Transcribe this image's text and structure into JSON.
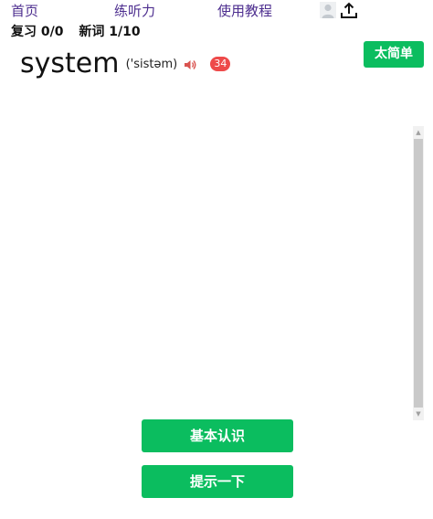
{
  "nav": {
    "home": "首页",
    "listening": "练听力",
    "tutorial": "使用教程",
    "avatar_icon": "user-avatar-icon",
    "upload_icon": "upload-icon"
  },
  "progress": {
    "review": "复习 0/0",
    "new_words": "新词 1/10"
  },
  "word": {
    "text": "system",
    "phonetic": "('sistəm)",
    "speaker_icon": "speaker-icon",
    "badge": "34"
  },
  "actions": {
    "too_easy": "太简单",
    "basic_known": "基本认识",
    "hint": "提示一下"
  },
  "colors": {
    "accent_green": "#0bbd5f",
    "nav_link": "#4d2e8f",
    "badge_red": "#ee4a4a",
    "speaker_red": "#d9534f"
  }
}
